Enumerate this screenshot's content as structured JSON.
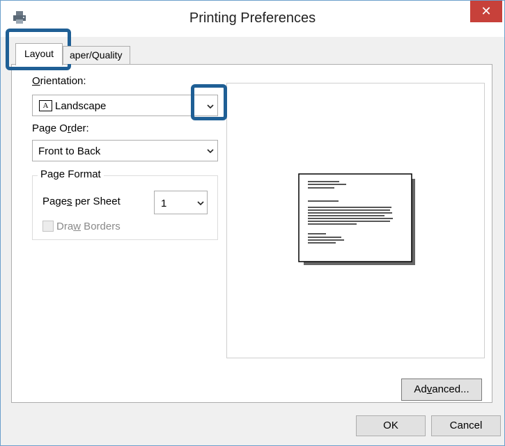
{
  "window": {
    "title": "Printing Preferences",
    "close_glyph": "✕",
    "icon": "printer-icon"
  },
  "tabs": [
    {
      "label": "Layout",
      "selected": true
    },
    {
      "label": "Paper/Quality",
      "visible_text": "aper/Quality",
      "selected": false
    }
  ],
  "orientation": {
    "label_prefix": "",
    "label_accel": "O",
    "label_rest": "rientation:",
    "value": "Landscape",
    "value_icon": "A",
    "icon": "landscape-page-icon"
  },
  "page_order": {
    "label_prefix": "Page O",
    "label_accel": "r",
    "label_rest": "der:",
    "value": "Front to Back"
  },
  "page_format": {
    "title": "Page Format",
    "pages_per_sheet": {
      "label_prefix": "Page",
      "label_accel": "s",
      "label_rest": " per Sheet",
      "value": "1"
    },
    "draw_borders": {
      "label_prefix": "Dra",
      "label_accel": "w",
      "label_rest": " Borders",
      "checked": false,
      "enabled": false
    }
  },
  "buttons": {
    "advanced": {
      "prefix": "Ad",
      "accel": "v",
      "rest": "anced..."
    },
    "ok": "OK",
    "cancel": "Cancel"
  },
  "colors": {
    "highlight": "#1f5f95",
    "close_button": "#c7413a"
  }
}
